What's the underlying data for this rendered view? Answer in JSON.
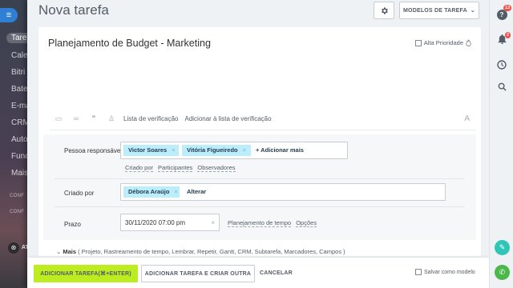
{
  "left_sidebar": {
    "items": [
      "Tare",
      "Cale",
      "Bitri",
      "Bate",
      "E-ma",
      "CRM",
      "Auto",
      "Func",
      "Mais"
    ],
    "active_index": 0,
    "conf_labels": [
      "CONF",
      "CONF"
    ],
    "bottom_label": "AT"
  },
  "header": {
    "title": "Nova tarefa",
    "templates_label": "MODELOS DE TAREFA"
  },
  "task": {
    "title": "Planejamento de Budget - Marketing",
    "priority_label": "Alta Prioridade"
  },
  "toolbar": {
    "checklist": "Lista de verificação",
    "add_to_checklist": "Adicionar à lista de verificação",
    "font_icon": "A"
  },
  "responsible": {
    "label": "Pessoa responsável",
    "people": [
      "Victor Soares",
      "Vitória Figueiredo"
    ],
    "add_more": "+ Adicionar mais",
    "links": [
      "Criado por",
      "Participantes",
      "Observadores"
    ]
  },
  "created_by": {
    "label": "Criado por",
    "person": "Débora Araújo",
    "change": "Alterar"
  },
  "deadline": {
    "label": "Prazo",
    "value": "30/11/2020 07:00 pm",
    "links": [
      "Planejamento de tempo",
      "Opções"
    ]
  },
  "more": {
    "label": "Mais",
    "items": "( Projeto,  Rastreamento de tempo,  Lembrar,  Repetir,  Gantt,  CRM,  Subtarefa,  Marcadores,  Campos )"
  },
  "actions": {
    "primary": "ADICIONAR TAREFA(⌘+ENTER)",
    "secondary": "ADICIONAR TAREFA E CRIAR OUTRA",
    "cancel": "CANCELAR",
    "save_template": "Salvar como modelo"
  },
  "right_sidebar": {
    "help_badge": "13",
    "bell_badge": "2"
  },
  "colors": {
    "primary_button": "#bbed21",
    "tag_bg": "#bcedfc",
    "badge": "#f0514a"
  }
}
